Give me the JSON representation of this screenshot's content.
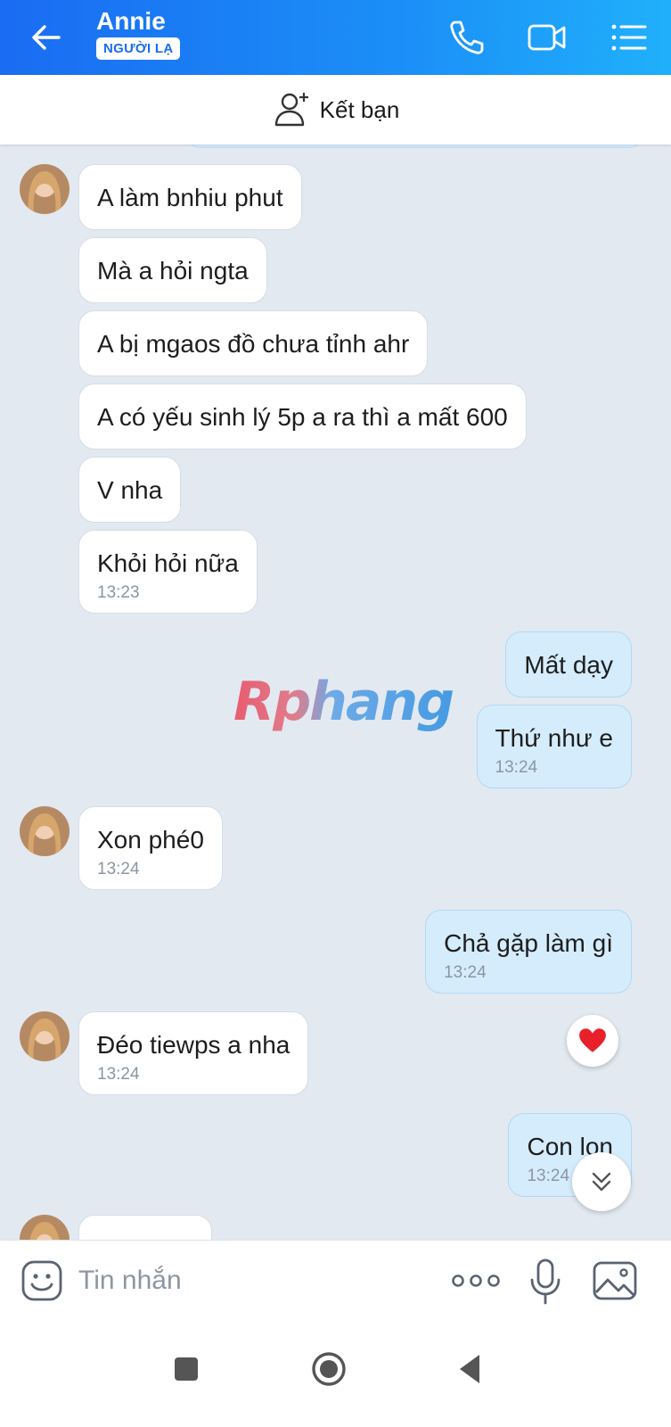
{
  "header": {
    "contact_name": "Annie",
    "stranger_badge": "NGƯỜI LẠ",
    "icons": [
      "back-arrow-icon",
      "phone-icon",
      "video-call-icon",
      "menu-list-icon"
    ]
  },
  "add_friend": {
    "label": "Kết bạn"
  },
  "watermark": "Rphang",
  "messages": [
    {
      "from": "contact",
      "text": "A làm bnhiu phut",
      "time": ""
    },
    {
      "from": "contact",
      "text": "Mà a hỏi ngta",
      "time": ""
    },
    {
      "from": "contact",
      "text": "A bị mgaos đồ chưa tỉnh ahr",
      "time": ""
    },
    {
      "from": "contact",
      "text": "A có yếu sinh lý 5p a ra thì a mất 600",
      "time": ""
    },
    {
      "from": "contact",
      "text": "V nha",
      "time": ""
    },
    {
      "from": "contact",
      "text": "Khỏi hỏi nữa",
      "time": "13:23"
    },
    {
      "from": "me",
      "text": "Mất dạy",
      "time": ""
    },
    {
      "from": "me",
      "text": "Thứ như e",
      "time": "13:24"
    },
    {
      "from": "contact",
      "text": "Xon phé0",
      "time": "13:24"
    },
    {
      "from": "me",
      "text": "Chả gặp làm gì",
      "time": "13:24"
    },
    {
      "from": "contact",
      "text": "Đéo tiewps a nha",
      "time": "13:24"
    },
    {
      "from": "me",
      "text": "Con lon",
      "time": "13:24"
    }
  ],
  "reaction": {
    "icon": "heart-icon",
    "color": "#e8202a"
  },
  "input": {
    "placeholder": "Tin nhắn"
  },
  "colors": {
    "header_start": "#1a6cf2",
    "header_end": "#20b0fb",
    "sent_bubble": "#d5ecfd",
    "received_bubble": "#ffffff",
    "background": "#e2e9f1"
  }
}
